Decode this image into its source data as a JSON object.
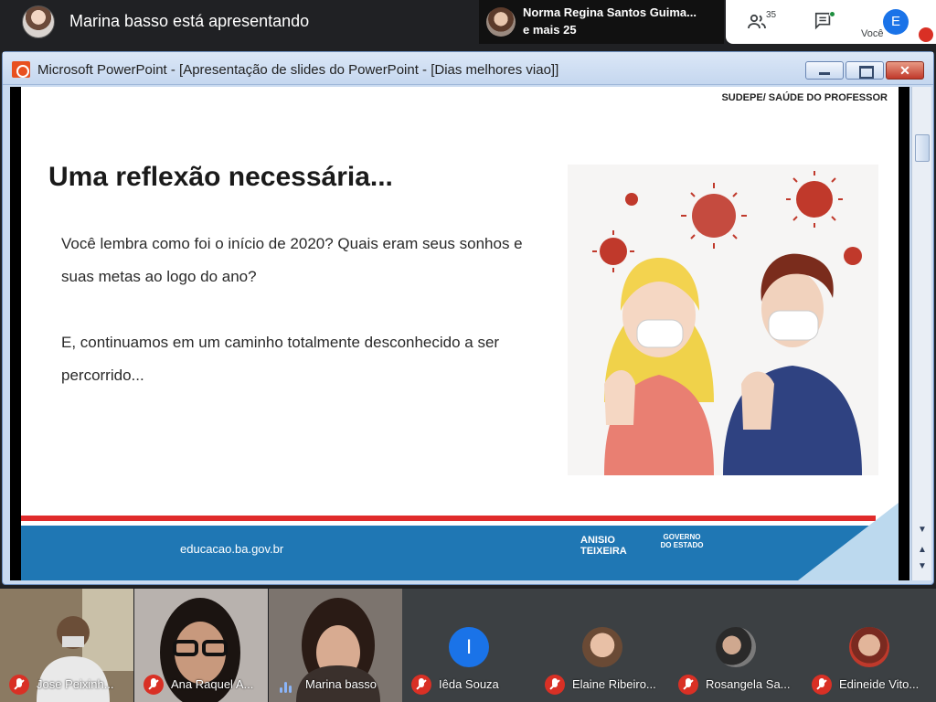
{
  "meet": {
    "presenter_text": "Marina basso está apresentando",
    "other_presenter": {
      "line1": "Norma Regina Santos Guima...",
      "line2": "e mais 25"
    },
    "participants_count": "35",
    "self": {
      "initial": "E",
      "label": "Você"
    }
  },
  "ppt": {
    "window_title": "Microsoft PowerPoint - [Apresentação de slides do PowerPoint - [Dias melhores viao]]",
    "close_glyph": "✕"
  },
  "slide": {
    "header": "SUDEPE/ SAÚDE DO PROFESSOR",
    "title": "Uma reflexão  necessária...",
    "paragraph1": "Você lembra como foi o início de 2020? Quais eram seus sonhos e suas metas ao logo do ano?",
    "paragraph2": "E, continuamos em um caminho totalmente desconhecido a ser percorrido...",
    "footer_link": "educacao.ba.gov.br",
    "logo_anisio": "ANISIO TEIXEIRA",
    "logo_gov": "GOVERNO DO ESTADO"
  },
  "participants": [
    {
      "name": "Jose Peixinh...",
      "type": "video",
      "muted": true
    },
    {
      "name": "Ana Raquel A...",
      "type": "video",
      "muted": true
    },
    {
      "name": "Marina basso",
      "type": "video",
      "muted": false
    },
    {
      "name": "Iêda Souza",
      "type": "avatar",
      "initial": "I",
      "muted": true
    },
    {
      "name": "Elaine Ribeiro...",
      "type": "photo",
      "muted": true
    },
    {
      "name": "Rosangela Sa...",
      "type": "photo",
      "muted": true
    },
    {
      "name": "Edineide Vito...",
      "type": "photo",
      "muted": true
    }
  ],
  "colors": {
    "meet_bg": "#202124",
    "accent_blue": "#1a73e8",
    "mute_red": "#d93025",
    "slide_footer_blue": "#1f77b4",
    "slide_red_line": "#e02b2b",
    "virus_red": "#c0392b"
  }
}
